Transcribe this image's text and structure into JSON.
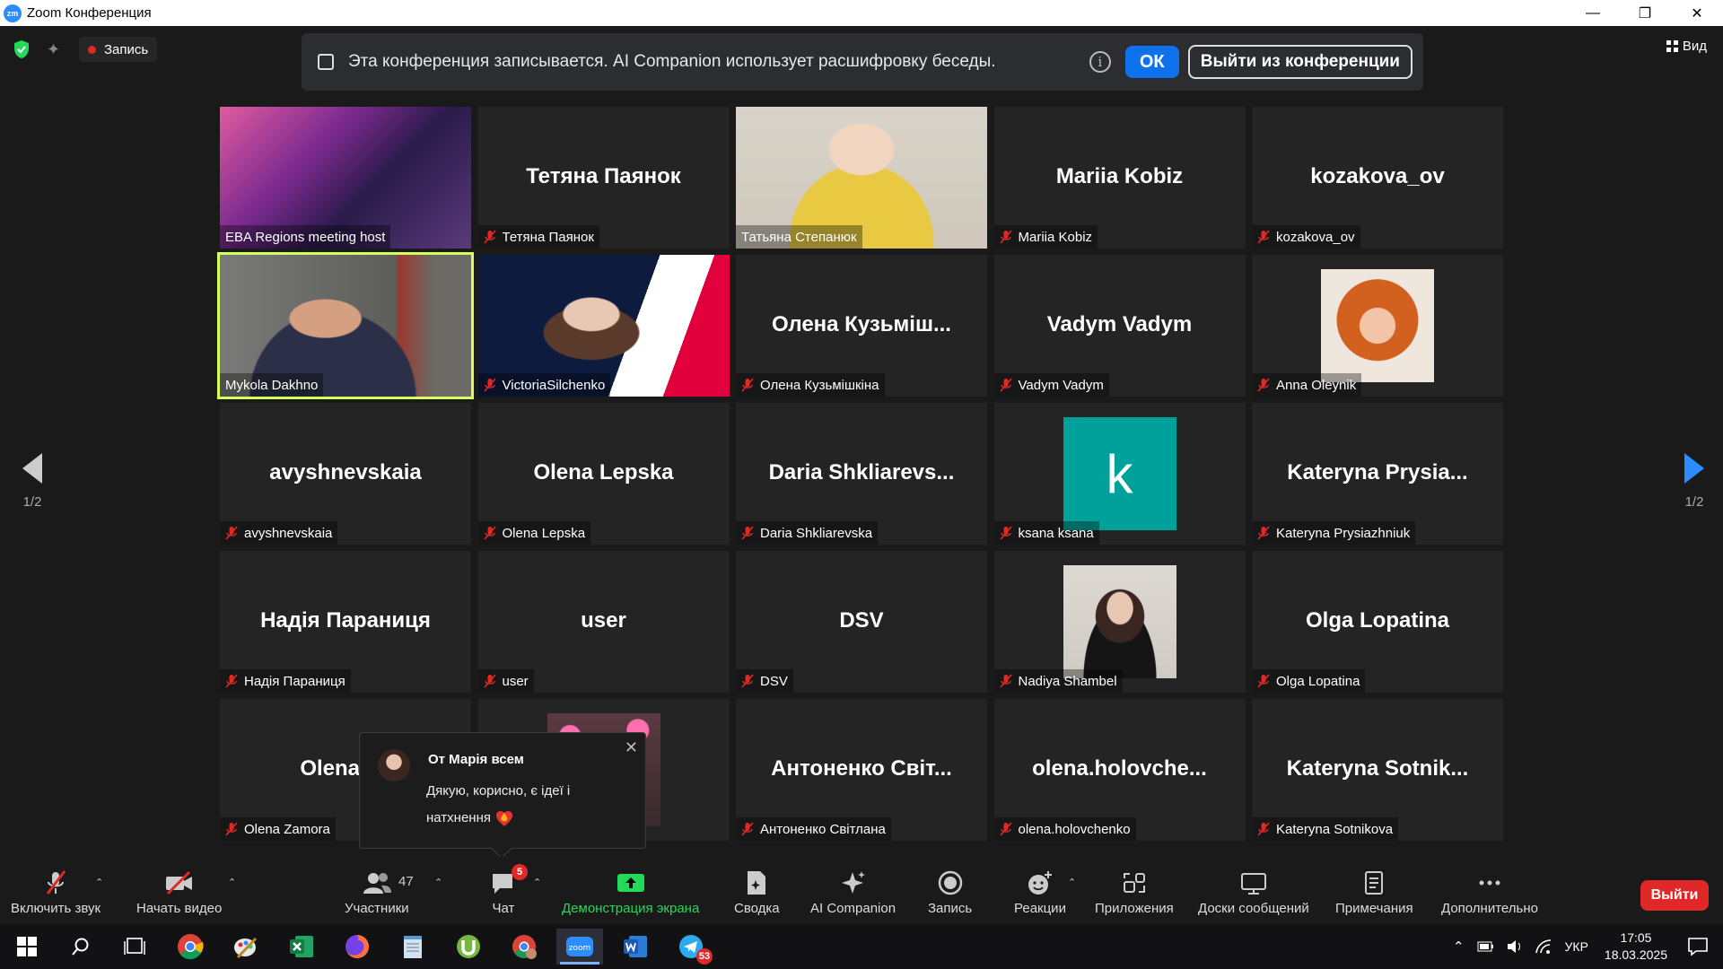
{
  "window": {
    "app_icon_text": "zm",
    "title": "Zoom Конференция",
    "minimize": "—",
    "maximize": "❐",
    "close": "✕"
  },
  "topbar": {
    "recording_label": "Запись",
    "banner": {
      "message": "Эта конференция записывается. AI Companion использует расшифровку беседы.",
      "ok_label": "ОК",
      "leave_label": "Выйти из конференции",
      "info": "i"
    },
    "view_label": "Вид"
  },
  "tiles": [
    {
      "label": "EBA Regions meeting host",
      "big": "",
      "muted": false,
      "type": "photo",
      "photo": "eba"
    },
    {
      "label": "Тетяна Паянок",
      "big": "Тетяна Паянок",
      "muted": true,
      "type": "name"
    },
    {
      "label": "Татьяна Степанюк",
      "big": "",
      "muted": false,
      "type": "photo",
      "photo": "yellow"
    },
    {
      "label": "Mariia Kobiz",
      "big": "Mariia Kobiz",
      "muted": true,
      "type": "name"
    },
    {
      "label": "kozakova_ov",
      "big": "kozakova_ov",
      "muted": true,
      "type": "name"
    },
    {
      "label": "Mykola Dakhno",
      "big": "",
      "muted": false,
      "type": "photo",
      "photo": "room",
      "active": true
    },
    {
      "label": "VictoriaSilchenko",
      "big": "",
      "muted": true,
      "type": "photo",
      "photo": "bdo"
    },
    {
      "label": "Олена Кузьмішкіна",
      "big": "Олена  Кузьміш...",
      "muted": true,
      "type": "name"
    },
    {
      "label": "Vadym Vadym",
      "big": "Vadym Vadym",
      "muted": true,
      "type": "name"
    },
    {
      "label": "Anna Oleynik",
      "big": "",
      "muted": true,
      "type": "avatar",
      "photo": "curly"
    },
    {
      "label": "avyshnevskaia",
      "big": "avyshnevskaia",
      "muted": true,
      "type": "name"
    },
    {
      "label": "Olena Lepska",
      "big": "Olena Lepska",
      "muted": true,
      "type": "name"
    },
    {
      "label": "Daria Shkliarevska",
      "big": "Daria  Shkliarevs...",
      "muted": true,
      "type": "name"
    },
    {
      "label": "ksana ksana",
      "big": "k",
      "muted": true,
      "type": "letter"
    },
    {
      "label": "Kateryna Prysiazhniuk",
      "big": "Kateryna  Prysia...",
      "muted": true,
      "type": "name"
    },
    {
      "label": "Надія Параниця",
      "big": "Надія Параниця",
      "muted": true,
      "type": "name"
    },
    {
      "label": "user",
      "big": "user",
      "muted": true,
      "type": "name"
    },
    {
      "label": "DSV",
      "big": "DSV",
      "muted": true,
      "type": "name"
    },
    {
      "label": "Nadiya Shambel",
      "big": "",
      "muted": true,
      "type": "avatar",
      "photo": "dark"
    },
    {
      "label": "Olga Lopatina",
      "big": "Olga Lopatina",
      "muted": true,
      "type": "name"
    },
    {
      "label": "Olena Zamora",
      "big": "Olena Za",
      "muted": true,
      "type": "name"
    },
    {
      "label": "",
      "big": "",
      "muted": false,
      "type": "avatar",
      "photo": "hearts"
    },
    {
      "label": "Антоненко Світлана",
      "big": "Антоненко  Світ...",
      "muted": true,
      "type": "name"
    },
    {
      "label": "olena.holovchenko",
      "big": "olena.holovche...",
      "muted": true,
      "type": "name"
    },
    {
      "label": "Kateryna Sotnikova",
      "big": "Kateryna  Sotnik...",
      "muted": true,
      "type": "name"
    }
  ],
  "nav": {
    "prev_page": "1/2",
    "next_page": "1/2"
  },
  "chat_popup": {
    "from": "От Марія всем",
    "message": "Дякую, корисно, є ідеї і натхнення",
    "close": "✕"
  },
  "toolbar": {
    "mute": "Включить звук",
    "video": "Начать видео",
    "participants": "Участники",
    "participants_count": "47",
    "chat": "Чат",
    "chat_badge": "5",
    "share": "Демонстрация экрана",
    "summary": "Сводка",
    "ai": "AI Companion",
    "record": "Запись",
    "reactions": "Реакции",
    "apps": "Приложения",
    "whiteboards": "Доски сообщений",
    "notes": "Примечания",
    "more": "Дополнительно",
    "leave": "Выйти"
  },
  "taskbar": {
    "telegram_badge": "53",
    "lang": "УКР",
    "time": "17:05",
    "date": "18.03.2025"
  },
  "colors": {
    "accent": "#0e72ed",
    "green": "#23d959",
    "red": "#e02828",
    "active_tile": "#d7ff5a",
    "ksana": "#00a19a"
  }
}
